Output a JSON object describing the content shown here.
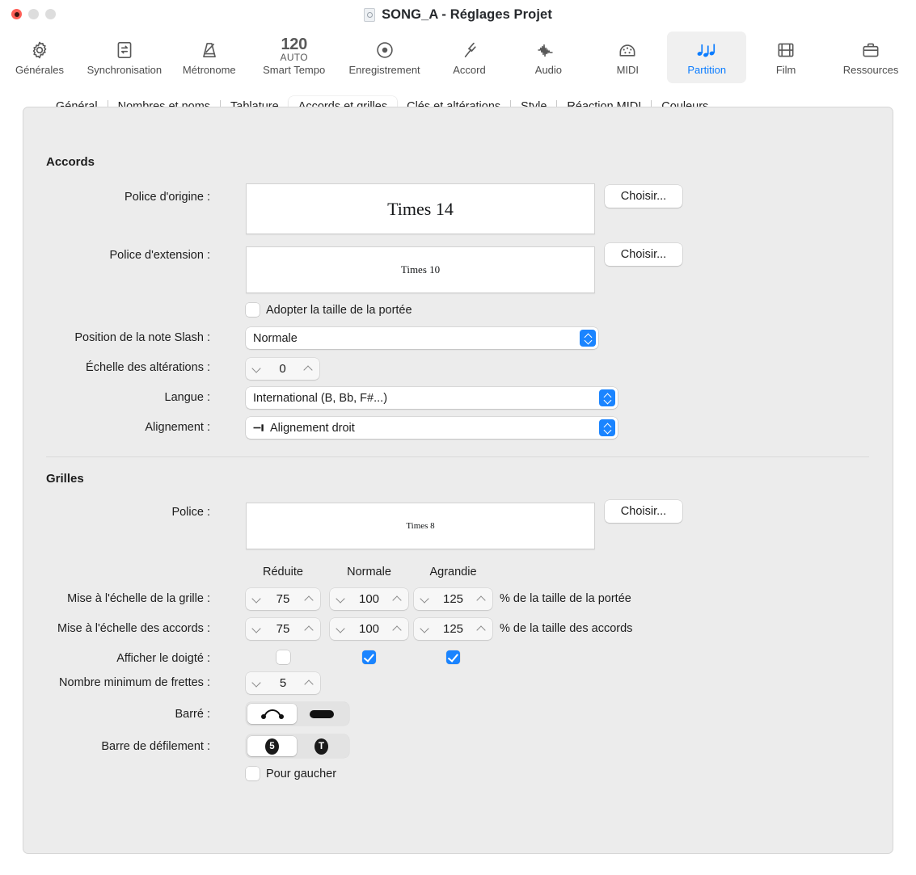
{
  "window": {
    "title": "SONG_A - Réglages Projet",
    "doc_icon": "document-icon",
    "traffic": {
      "close": "close-button",
      "minimize": "minimize-button",
      "zoom": "zoom-button"
    }
  },
  "toolbar": {
    "items": [
      {
        "label": "Générales",
        "icon": "gear-icon",
        "selected": false
      },
      {
        "label": "Synchronisation",
        "icon": "sync-icon",
        "selected": false
      },
      {
        "label": "Métronome",
        "icon": "metronome-icon",
        "selected": false
      },
      {
        "label": "Smart Tempo",
        "icon": "tempo-icon",
        "tempo": "120",
        "auto": "AUTO",
        "selected": false
      },
      {
        "label": "Enregistrement",
        "icon": "record-icon",
        "selected": false
      },
      {
        "label": "Accord",
        "icon": "tuning-fork-icon",
        "selected": false
      },
      {
        "label": "Audio",
        "icon": "waveform-icon",
        "selected": false
      },
      {
        "label": "MIDI",
        "icon": "midi-icon",
        "selected": false
      },
      {
        "label": "Partition",
        "icon": "notes-icon",
        "selected": true
      },
      {
        "label": "Film",
        "icon": "film-icon",
        "selected": false
      },
      {
        "label": "Ressources",
        "icon": "briefcase-icon",
        "selected": false
      }
    ],
    "accent": "#0a7cff"
  },
  "tabs": [
    {
      "label": "Général",
      "active": false
    },
    {
      "label": "Nombres et noms",
      "active": false
    },
    {
      "label": "Tablature",
      "active": false
    },
    {
      "label": "Accords et grilles",
      "active": true
    },
    {
      "label": "Clés et altérations",
      "active": false
    },
    {
      "label": "Style",
      "active": false
    },
    {
      "label": "Réaction MIDI",
      "active": false
    },
    {
      "label": "Couleurs",
      "active": false
    }
  ],
  "accords": {
    "section_title": "Accords",
    "police_origine": {
      "label": "Police d'origine :",
      "value": "Times 14",
      "button": "Choisir...",
      "preview_size": "22px"
    },
    "police_extension": {
      "label": "Police d'extension :",
      "value": "Times 10",
      "button": "Choisir...",
      "preview_size": "14px"
    },
    "adopter_taille": {
      "label": "Adopter la taille de la portée",
      "checked": false
    },
    "position_slash": {
      "label": "Position de la note Slash :",
      "value": "Normale"
    },
    "echelle_alterations": {
      "label": "Échelle des altérations :",
      "value": "0"
    },
    "langue": {
      "label": "Langue :",
      "value": "International (B, Bb, F#...)"
    },
    "alignement": {
      "label": "Alignement :",
      "value": "Alignement droit",
      "icon": "align-right-icon"
    }
  },
  "grilles": {
    "section_title": "Grilles",
    "police": {
      "label": "Police :",
      "value": "Times 8",
      "button": "Choisir...",
      "preview_size": "12px"
    },
    "columns": [
      "Réduite",
      "Normale",
      "Agrandie"
    ],
    "echelle_grille": {
      "label": "Mise à l'échelle de la grille :",
      "values": [
        "75",
        "100",
        "125"
      ],
      "suffix": "% de la taille de la portée"
    },
    "echelle_accords": {
      "label": "Mise à l'échelle des accords :",
      "values": [
        "75",
        "100",
        "125"
      ],
      "suffix": "% de la taille des accords"
    },
    "afficher_doigte": {
      "label": "Afficher le doigté :",
      "checked": [
        false,
        true,
        true
      ]
    },
    "nombre_frettes": {
      "label": "Nombre minimum de frettes :",
      "value": "5"
    },
    "barre": {
      "label": "Barré :",
      "options": [
        "barre-arc-icon",
        "barre-bar-icon"
      ],
      "selected": 0
    },
    "barre_defilement": {
      "label": "Barre de défilement :",
      "options": [
        "5",
        "T"
      ],
      "selected": 0
    },
    "pour_gaucher": {
      "label": "Pour gaucher",
      "checked": false
    }
  },
  "colors": {
    "accent_blue": "#1a84ff",
    "panel_bg": "#ececec",
    "window_bg": "#ffffff"
  }
}
